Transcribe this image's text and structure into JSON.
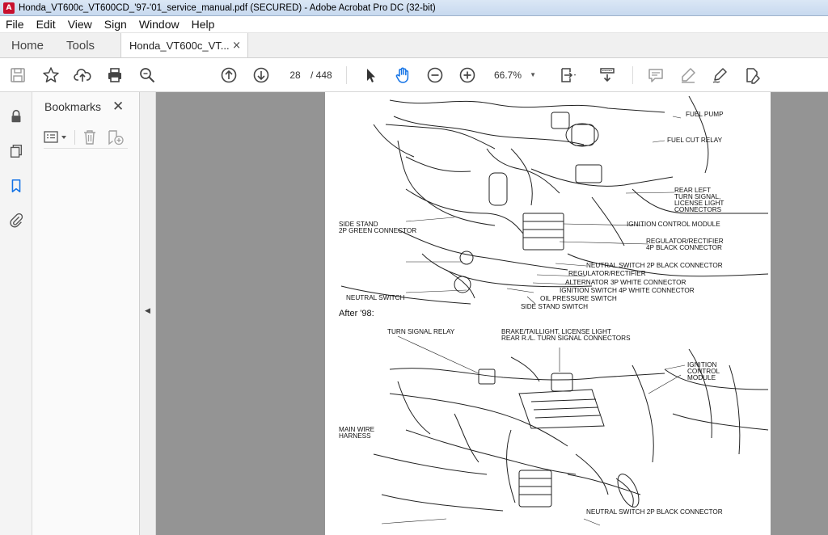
{
  "window": {
    "title": "Honda_VT600c_VT600CD_'97-'01_service_manual.pdf (SECURED) - Adobe Acrobat Pro DC (32-bit)"
  },
  "menu": [
    "File",
    "Edit",
    "View",
    "Sign",
    "Window",
    "Help"
  ],
  "tabs": {
    "home": "Home",
    "tools": "Tools",
    "document": "Honda_VT600c_VT...",
    "close": "×"
  },
  "toolbar": {
    "page_current": "28",
    "page_total": "/ 448",
    "zoom": "66.7%",
    "icons": [
      "save-icon",
      "star-icon",
      "upload-icon",
      "print-icon",
      "search-icon",
      "page-up-icon",
      "page-down-icon",
      "select-cursor-icon",
      "hand-icon",
      "zoom-out-icon",
      "zoom-in-icon",
      "page-display-icon",
      "scroll-mode-icon",
      "comment-icon",
      "highlight-icon",
      "sign-icon",
      "fill-sign-icon"
    ]
  },
  "sidebar": {
    "title": "Bookmarks",
    "close": "✕"
  },
  "page": {
    "heading_after": "After '98:",
    "labels_top": {
      "fuel_pump": "FUEL PUMP",
      "fuel_cut_relay": "FUEL CUT RELAY",
      "rear_left_1": "REAR LEFT",
      "rear_left_2": "TURN SIGNAL,",
      "rear_left_3": "LICENSE LIGHT",
      "rear_left_4": "CONNECTORS",
      "ignition_control_module": "IGNITION CONTROL MODULE",
      "regulator_rectifier_4p_1": "REGULATOR/RECTIFIER",
      "regulator_rectifier_4p_2": "4P BLACK CONNECTOR",
      "side_stand_2p_1": "SIDE STAND",
      "side_stand_2p_2": "2P GREEN CONNECTOR",
      "neutral_switch_2p": "NEUTRAL SWITCH 2P BLACK CONNECTOR",
      "regulator_rectifier": "REGULATOR/RECTIFIER",
      "alternator_3p": "ALTERNATOR 3P WHITE CONNECTOR",
      "ignition_switch_4p": "IGNITION SWITCH 4P WHITE CONNECTOR",
      "oil_pressure_switch": "OIL PRESSURE SWITCH",
      "neutral_switch": "NEUTRAL SWITCH",
      "side_stand_switch": "SIDE STAND SWITCH"
    },
    "labels_bottom": {
      "turn_signal_relay": "TURN SIGNAL RELAY",
      "brake_taillight_1": "BRAKE/TAILLIGHT, LICENSE LIGHT",
      "brake_taillight_2": "REAR R./L. TURN SIGNAL CONNECTORS",
      "ignition_1": "IGNITION",
      "ignition_2": "CONTROL",
      "ignition_3": "MODULE",
      "main_wire_1": "MAIN WIRE",
      "main_wire_2": "HARNESS",
      "neutral_switch_2p": "NEUTRAL SWITCH 2P BLACK CONNECTOR"
    }
  }
}
